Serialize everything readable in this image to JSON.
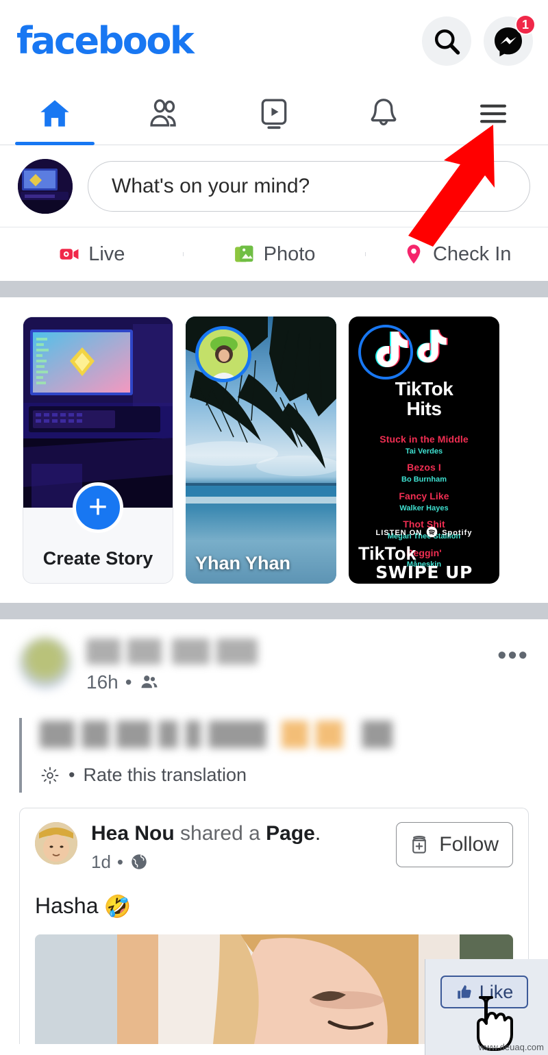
{
  "app": {
    "name": "Facebook",
    "logo_text": "facebook",
    "brand_color": "#1877F2"
  },
  "topbar": {
    "search_icon": "search-icon",
    "messenger_icon": "messenger-icon",
    "messenger_badge": "1"
  },
  "navtabs": [
    {
      "name": "home",
      "icon": "home-icon",
      "active": true
    },
    {
      "name": "friends",
      "icon": "friends-icon",
      "active": false
    },
    {
      "name": "watch",
      "icon": "video-play-icon",
      "active": false
    },
    {
      "name": "notifications",
      "icon": "bell-icon",
      "active": false
    },
    {
      "name": "menu",
      "icon": "hamburger-menu-icon",
      "active": false
    }
  ],
  "composer": {
    "placeholder": "What's on your mind?",
    "avatar_alt": "user-avatar"
  },
  "composer_actions": [
    {
      "label": "Live",
      "icon": "live-video-icon",
      "color": "#F02849"
    },
    {
      "label": "Photo",
      "icon": "photo-icon",
      "color": "#7CC440"
    },
    {
      "label": "Check In",
      "icon": "location-pin-icon",
      "color": "#F5256B"
    }
  ],
  "stories": [
    {
      "type": "create",
      "label": "Create Story",
      "plus": "+"
    },
    {
      "type": "story",
      "name": "Yhan Yhan"
    },
    {
      "type": "story",
      "name": "TikTok",
      "title_line1": "TikTok",
      "title_line2": "Hits",
      "swipe": "SWIPE UP",
      "listen_on": "LISTEN ON",
      "spotify": "Spotify",
      "tracks": [
        {
          "song": "Stuck in the Middle",
          "artist": "Tai Verdes"
        },
        {
          "song": "Bezos I",
          "artist": "Bo Burnham"
        },
        {
          "song": "Fancy Like",
          "artist": "Walker Hayes"
        },
        {
          "song": "Thot Shit",
          "artist": "Megan Thee Stallion"
        },
        {
          "song": "Beggin'",
          "artist": "Måneskin"
        }
      ]
    }
  ],
  "post": {
    "author": "",
    "time": "16h",
    "audience_icon": "friends-audience-icon",
    "more_icon": "more-options-icon",
    "more_label": "•••",
    "body_text": "",
    "rate_translation": "Rate this translation",
    "rate_gear_icon": "gear-icon",
    "bullet": "•"
  },
  "shared_card": {
    "author": "Hea Nou",
    "shared_text": "shared a",
    "object_type": "Page",
    "period": ".",
    "time": "1d",
    "privacy_icon": "globe-icon",
    "bullet": "•",
    "follow_label": "Follow",
    "follow_icon": "follow-plus-icon",
    "caption": "Hasha",
    "caption_emoji": "🤣"
  },
  "like_overlay": {
    "label": "Like",
    "thumb_icon": "thumbs-up-icon",
    "cursor_icon": "hand-pointer-cursor",
    "watermark": "www.deuaq.com"
  },
  "annotation": {
    "arrow": "red-arrow-pointing-to-menu",
    "color": "#FF0000",
    "target": "hamburger-menu-icon"
  }
}
